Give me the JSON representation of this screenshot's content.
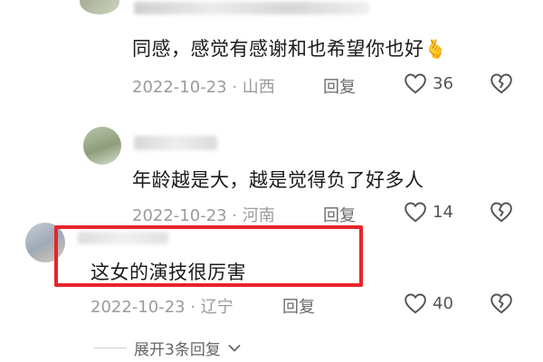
{
  "comments": [
    {
      "text": "同感，感觉有感谢和也希望你也好",
      "emoji": "🫰",
      "date": "2022-10-23",
      "location": "山西",
      "reply_label": "回复",
      "likes": "36",
      "highlighted": false
    },
    {
      "text": "年龄越是大，越是觉得负了好多人",
      "date": "2022-10-23",
      "location": "河南",
      "reply_label": "回复",
      "likes": "14",
      "highlighted": false
    },
    {
      "text": "这女的演技很厉害",
      "date": "2022-10-23",
      "location": "辽宁",
      "reply_label": "回复",
      "likes": "40",
      "highlighted": true
    }
  ],
  "expand_replies_label": "展开3条回复",
  "colors": {
    "highlight_border": "#e8252a",
    "meta_text": "#9b9b9b",
    "content_text": "#1a1a1a"
  }
}
